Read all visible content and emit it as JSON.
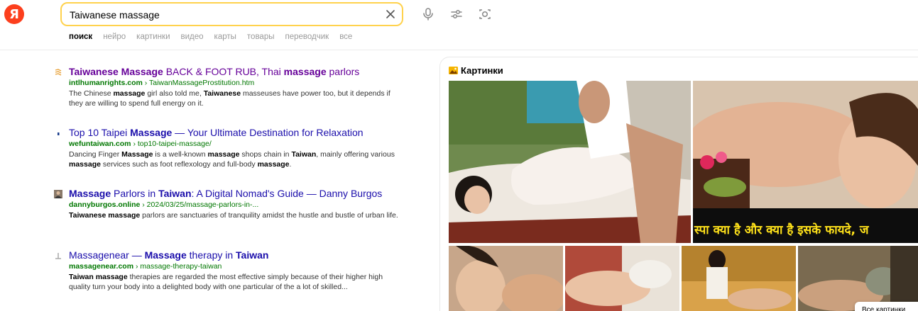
{
  "app": {
    "logo": "Я"
  },
  "search": {
    "query": "Taiwanese massage"
  },
  "header_icons": [
    "mic-icon",
    "filters-icon",
    "camera-icon",
    "clear-icon"
  ],
  "tabs": [
    {
      "label": "поиск",
      "active": true
    },
    {
      "label": "нейро",
      "active": false
    },
    {
      "label": "картинки",
      "active": false
    },
    {
      "label": "видео",
      "active": false
    },
    {
      "label": "карты",
      "active": false
    },
    {
      "label": "товары",
      "active": false
    },
    {
      "label": "переводчик",
      "active": false
    },
    {
      "label": "все",
      "active": false
    }
  ],
  "results": [
    {
      "title_parts": [
        [
          "Taiwanese Massage",
          true
        ],
        [
          " BACK & FOOT RUB, Thai ",
          false
        ],
        [
          "massage",
          true
        ],
        [
          " parlors",
          false
        ]
      ],
      "visited": true,
      "domain": "intlhumanrights.com",
      "path": "› TaiwanMassageProstitution.htm",
      "snippet_parts": [
        [
          "The Chinese ",
          false
        ],
        [
          "massage",
          true
        ],
        [
          " girl also told me, ",
          false
        ],
        [
          "Taiwanese",
          true
        ],
        [
          " masseuses have power too, but it depends if they are willing to spend full energy on it.",
          false
        ]
      ]
    },
    {
      "title_parts": [
        [
          "Top 10 Taipei ",
          false
        ],
        [
          "Massage",
          true
        ],
        [
          " — Your Ultimate Destination for Relaxation",
          false
        ]
      ],
      "visited": false,
      "domain": "wefuntaiwan.com",
      "path": "› top10-taipei-massage/",
      "snippet_parts": [
        [
          "Dancing Finger ",
          false
        ],
        [
          "Massage",
          true
        ],
        [
          " is a well-known ",
          false
        ],
        [
          "massage",
          true
        ],
        [
          " shops chain in ",
          false
        ],
        [
          "Taiwan",
          true
        ],
        [
          ", mainly offering various ",
          false
        ],
        [
          "massage",
          true
        ],
        [
          " services such as foot reflexology and full-body ",
          false
        ],
        [
          "massage",
          true
        ],
        [
          ".",
          false
        ]
      ]
    },
    {
      "title_parts": [
        [
          "Massage",
          true
        ],
        [
          " Parlors in ",
          false
        ],
        [
          "Taiwan",
          true
        ],
        [
          ": A Digital Nomad's Guide — Danny Burgos",
          false
        ]
      ],
      "visited": false,
      "domain": "dannyburgos.online",
      "path": "› 2024/03/25/massage-parlors-in-...",
      "snippet_parts": [
        [
          "Taiwanese massage",
          true
        ],
        [
          " parlors are sanctuaries of tranquility amidst the hustle and bustle of urban life.",
          false
        ]
      ]
    },
    {
      "title_parts": [
        [
          "Massagenear — ",
          false
        ],
        [
          "Massage",
          true
        ],
        [
          " therapy in ",
          false
        ],
        [
          "Taiwan",
          true
        ]
      ],
      "visited": false,
      "domain": "massagenear.com",
      "path": "› massage-therapy-taiwan",
      "snippet_parts": [
        [
          "Taiwan massage",
          true
        ],
        [
          " therapies are regarded the most effective simply because of their higher high quality turn your body into a delighted body with one particular of the a lot of skilled...",
          false
        ]
      ]
    }
  ],
  "images": {
    "heading": "Картинки",
    "overlay_text": "स्पा क्या है और क्या है इसके फायदे, ज",
    "all_button": "Все картинки"
  }
}
